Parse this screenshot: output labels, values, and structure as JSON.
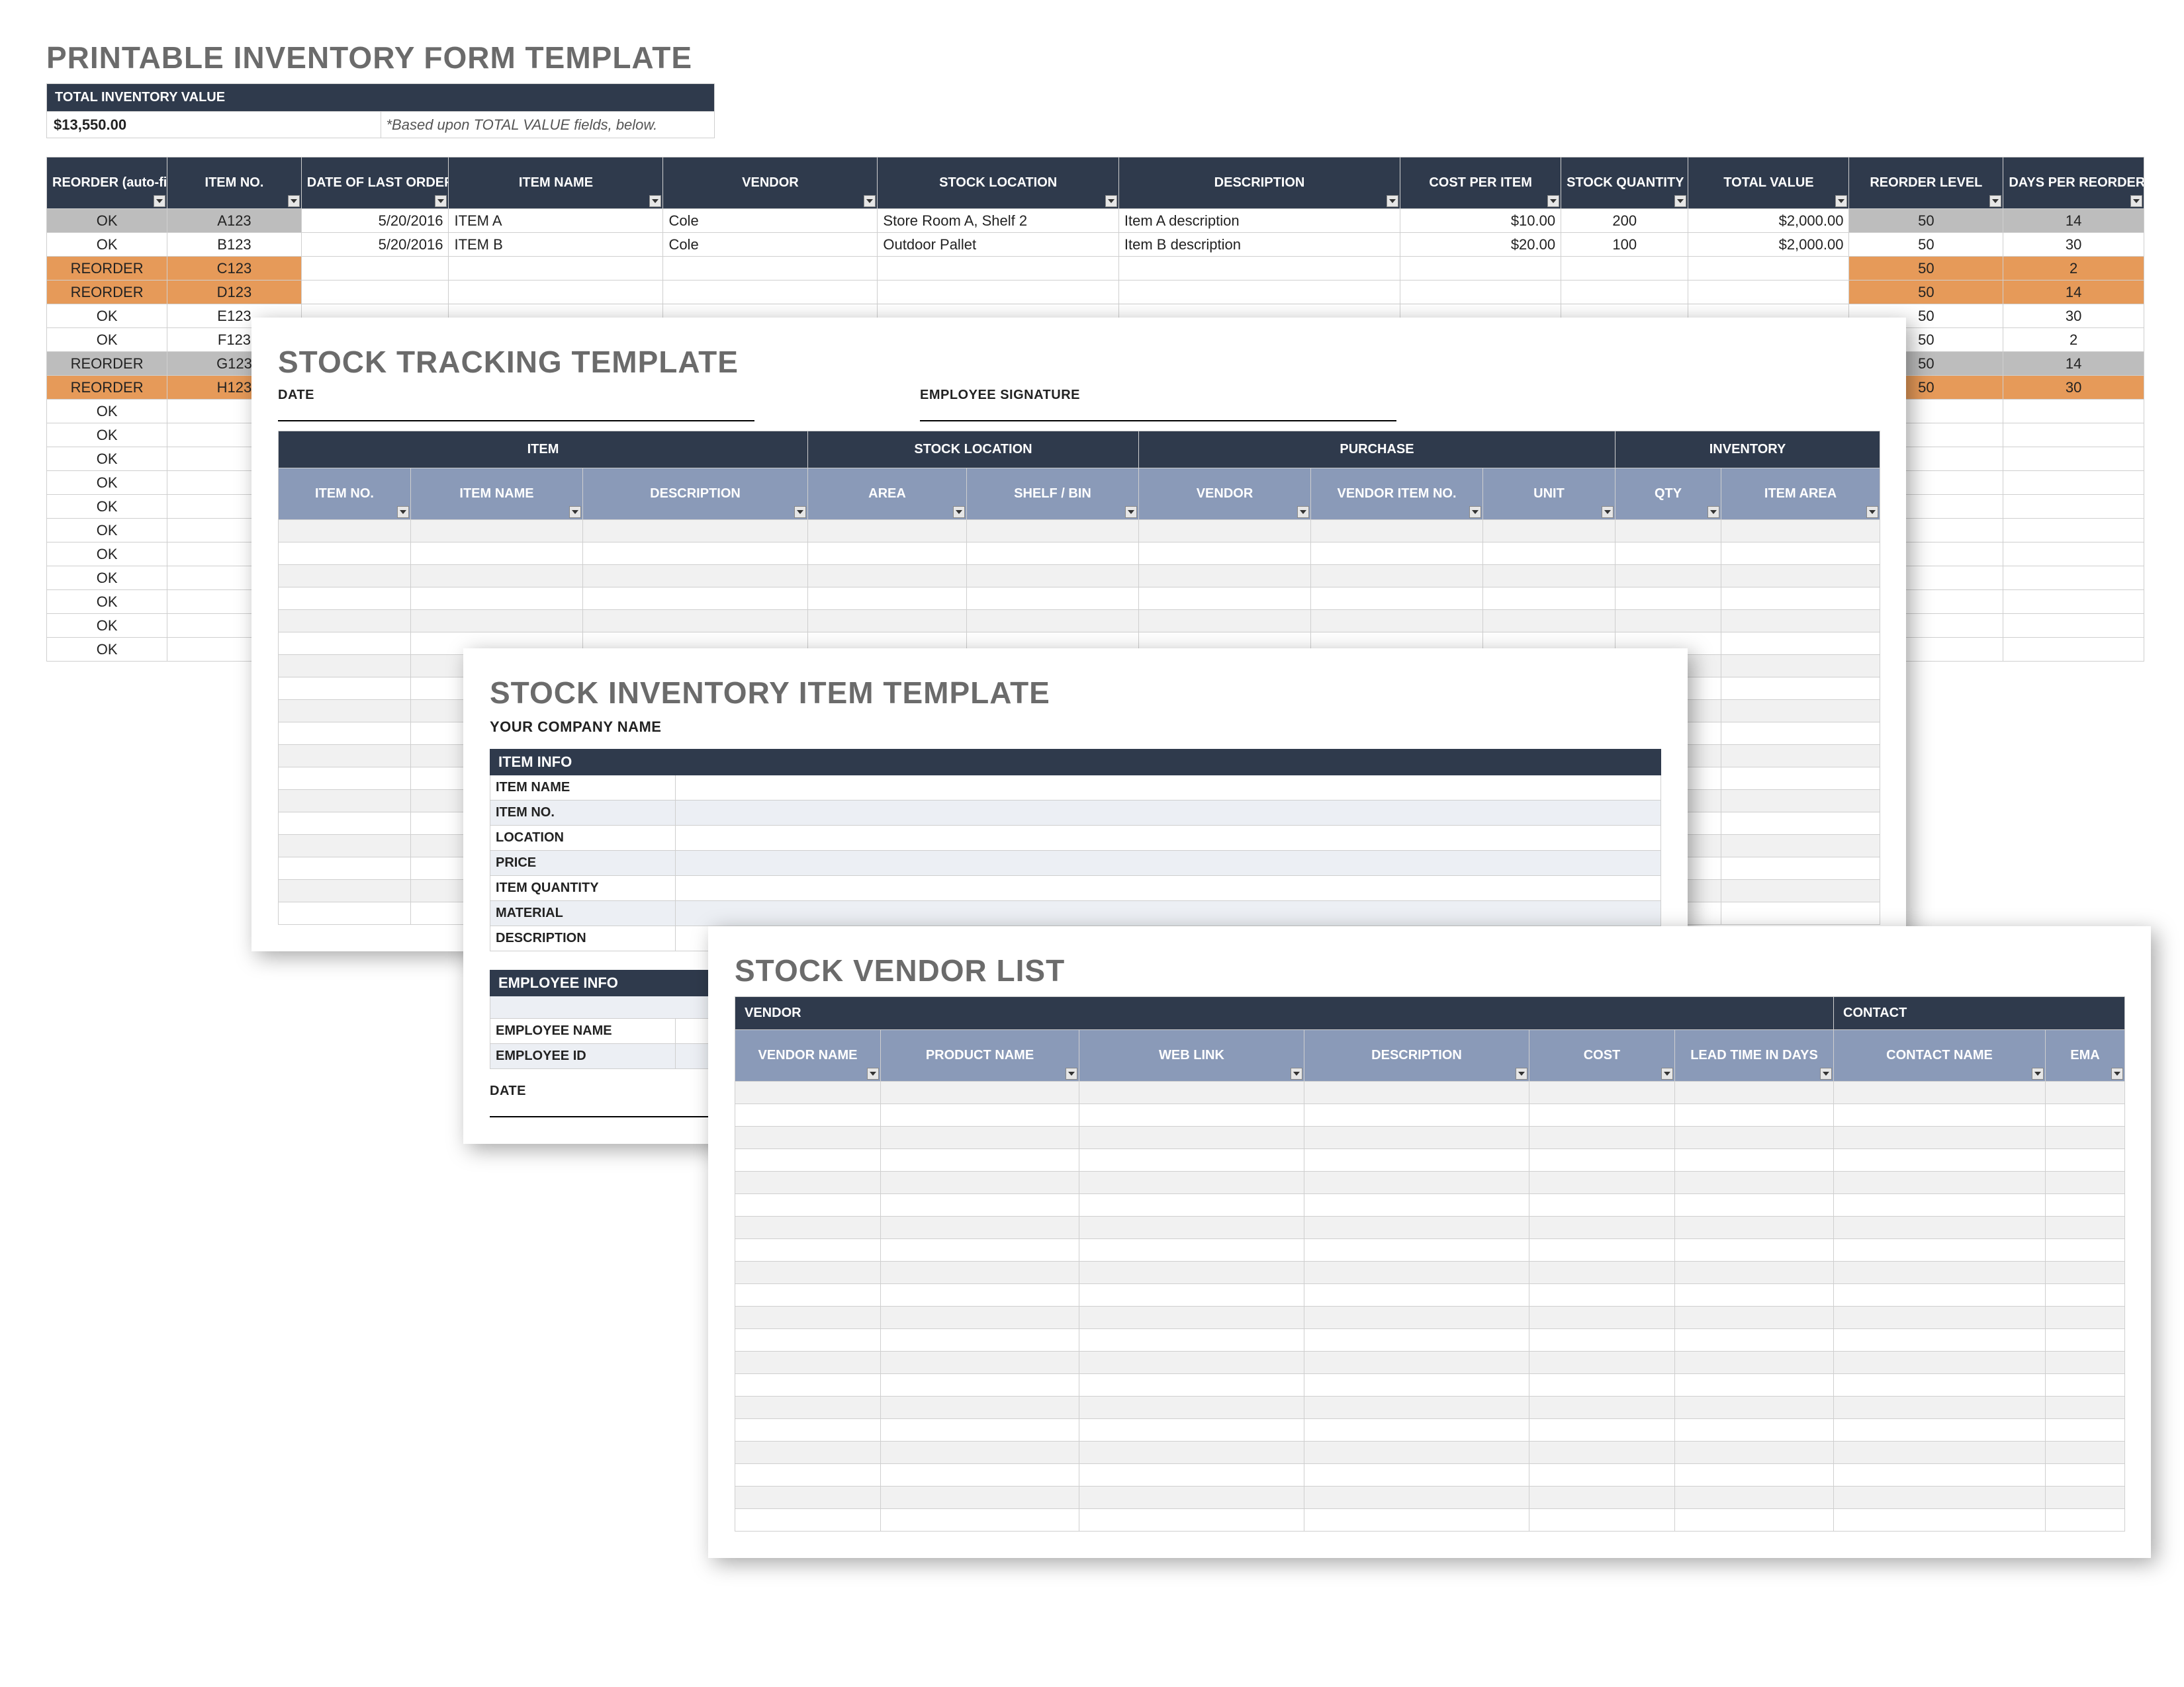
{
  "panel1": {
    "title": "PRINTABLE INVENTORY FORM TEMPLATE",
    "total_label": "TOTAL INVENTORY VALUE",
    "total_value": "$13,550.00",
    "total_note": "*Based upon TOTAL VALUE fields, below.",
    "cols": [
      "REORDER (auto-fill)",
      "ITEM NO.",
      "DATE OF LAST ORDER",
      "ITEM NAME",
      "VENDOR",
      "STOCK LOCATION",
      "DESCRIPTION",
      "COST PER ITEM",
      "STOCK QUANTITY",
      "TOTAL VALUE",
      "REORDER LEVEL",
      "DAYS PER REORDER"
    ],
    "rows": [
      {
        "status": "OK",
        "st_class": "graysel",
        "item": "A123",
        "date": "5/20/2016",
        "name": "ITEM A",
        "vendor": "Cole",
        "loc": "Store Room A, Shelf 2",
        "desc": "Item A description",
        "cost": "$10.00",
        "qty": "200",
        "total": "$2,000.00",
        "reord": "50",
        "days": "14"
      },
      {
        "status": "OK",
        "st_class": "ok",
        "item": "B123",
        "date": "5/20/2016",
        "name": "ITEM B",
        "vendor": "Cole",
        "loc": "Outdoor Pallet",
        "desc": "Item B description",
        "cost": "$20.00",
        "qty": "100",
        "total": "$2,000.00",
        "reord": "50",
        "days": "30"
      },
      {
        "status": "REORDER",
        "st_class": "reorder",
        "item": "C123",
        "date": "",
        "name": "",
        "vendor": "",
        "loc": "",
        "desc": "",
        "cost": "",
        "qty": "",
        "total": "",
        "reord": "50",
        "days": "2"
      },
      {
        "status": "REORDER",
        "st_class": "reorder",
        "item": "D123",
        "date": "",
        "name": "",
        "vendor": "",
        "loc": "",
        "desc": "",
        "cost": "",
        "qty": "",
        "total": "",
        "reord": "50",
        "days": "14"
      },
      {
        "status": "OK",
        "st_class": "ok",
        "item": "E123",
        "date": "",
        "name": "",
        "vendor": "",
        "loc": "",
        "desc": "",
        "cost": "",
        "qty": "",
        "total": "",
        "reord": "50",
        "days": "30"
      },
      {
        "status": "OK",
        "st_class": "ok",
        "item": "F123",
        "date": "",
        "name": "",
        "vendor": "",
        "loc": "",
        "desc": "",
        "cost": "",
        "qty": "",
        "total": "",
        "reord": "50",
        "days": "2"
      },
      {
        "status": "REORDER",
        "st_class": "graysel",
        "item": "G123",
        "date": "",
        "name": "",
        "vendor": "",
        "loc": "",
        "desc": "",
        "cost": "",
        "qty": "",
        "total": "",
        "reord": "50",
        "days": "14"
      },
      {
        "status": "REORDER",
        "st_class": "reorder",
        "item": "H123",
        "date": "",
        "name": "",
        "vendor": "",
        "loc": "",
        "desc": "",
        "cost": "",
        "qty": "",
        "total": "",
        "reord": "50",
        "days": "30"
      },
      {
        "status": "OK",
        "st_class": "ok",
        "item": "",
        "date": "",
        "name": "",
        "vendor": "",
        "loc": "",
        "desc": "",
        "cost": "",
        "qty": "",
        "total": "",
        "reord": "",
        "days": ""
      },
      {
        "status": "OK",
        "st_class": "ok",
        "item": "",
        "date": "",
        "name": "",
        "vendor": "",
        "loc": "",
        "desc": "",
        "cost": "",
        "qty": "",
        "total": "",
        "reord": "",
        "days": ""
      },
      {
        "status": "OK",
        "st_class": "ok",
        "item": "",
        "date": "",
        "name": "",
        "vendor": "",
        "loc": "",
        "desc": "",
        "cost": "",
        "qty": "",
        "total": "",
        "reord": "",
        "days": ""
      },
      {
        "status": "OK",
        "st_class": "ok",
        "item": "",
        "date": "",
        "name": "",
        "vendor": "",
        "loc": "",
        "desc": "",
        "cost": "",
        "qty": "",
        "total": "",
        "reord": "",
        "days": ""
      },
      {
        "status": "OK",
        "st_class": "ok",
        "item": "",
        "date": "",
        "name": "",
        "vendor": "",
        "loc": "",
        "desc": "",
        "cost": "",
        "qty": "",
        "total": "",
        "reord": "",
        "days": ""
      },
      {
        "status": "OK",
        "st_class": "ok",
        "item": "",
        "date": "",
        "name": "",
        "vendor": "",
        "loc": "",
        "desc": "",
        "cost": "",
        "qty": "",
        "total": "",
        "reord": "",
        "days": ""
      },
      {
        "status": "OK",
        "st_class": "ok",
        "item": "",
        "date": "",
        "name": "",
        "vendor": "",
        "loc": "",
        "desc": "",
        "cost": "",
        "qty": "",
        "total": "",
        "reord": "",
        "days": ""
      },
      {
        "status": "OK",
        "st_class": "ok",
        "item": "",
        "date": "",
        "name": "",
        "vendor": "",
        "loc": "",
        "desc": "",
        "cost": "",
        "qty": "",
        "total": "",
        "reord": "",
        "days": ""
      },
      {
        "status": "OK",
        "st_class": "ok",
        "item": "",
        "date": "",
        "name": "",
        "vendor": "",
        "loc": "",
        "desc": "",
        "cost": "",
        "qty": "",
        "total": "",
        "reord": "",
        "days": ""
      },
      {
        "status": "OK",
        "st_class": "ok",
        "item": "",
        "date": "",
        "name": "",
        "vendor": "",
        "loc": "",
        "desc": "",
        "cost": "",
        "qty": "",
        "total": "",
        "reord": "",
        "days": ""
      },
      {
        "status": "OK",
        "st_class": "ok",
        "item": "",
        "date": "",
        "name": "",
        "vendor": "",
        "loc": "",
        "desc": "",
        "cost": "",
        "qty": "",
        "total": "",
        "reord": "",
        "days": ""
      }
    ]
  },
  "panel2": {
    "title": "STOCK TRACKING TEMPLATE",
    "date_label": "DATE",
    "sig_label": "EMPLOYEE SIGNATURE",
    "groups": [
      "ITEM",
      "STOCK LOCATION",
      "PURCHASE",
      "INVENTORY"
    ],
    "cols": [
      "ITEM NO.",
      "ITEM NAME",
      "DESCRIPTION",
      "AREA",
      "SHELF / BIN",
      "VENDOR",
      "VENDOR ITEM NO.",
      "UNIT",
      "QTY",
      "ITEM AREA"
    ],
    "blank_rows": 18
  },
  "panel3": {
    "title": "STOCK INVENTORY ITEM TEMPLATE",
    "company_label": "YOUR COMPANY NAME",
    "section1": "ITEM INFO",
    "fields1": [
      "ITEM NAME",
      "ITEM NO.",
      "LOCATION",
      "PRICE",
      "ITEM QUANTITY",
      "MATERIAL",
      "DESCRIPTION"
    ],
    "section2": "EMPLOYEE INFO",
    "fields2": [
      "EMPLOYEE NAME",
      "EMPLOYEE ID"
    ],
    "date_label": "DATE"
  },
  "panel4": {
    "title": "STOCK VENDOR LIST",
    "groups": [
      "VENDOR",
      "CONTACT"
    ],
    "cols": [
      "VENDOR NAME",
      "PRODUCT NAME",
      "WEB LINK",
      "DESCRIPTION",
      "COST",
      "LEAD TIME IN DAYS",
      "CONTACT NAME",
      "EMA"
    ],
    "blank_rows": 20
  }
}
